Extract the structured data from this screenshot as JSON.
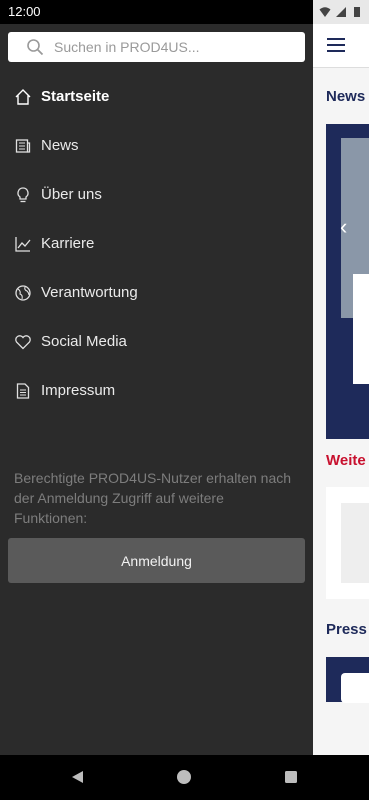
{
  "status": {
    "time": "12:00"
  },
  "drawer": {
    "search_placeholder": "Suchen in PROD4US...",
    "items": [
      {
        "label": "Startseite",
        "icon": "home-icon",
        "active": true
      },
      {
        "label": "News",
        "icon": "newspaper-icon"
      },
      {
        "label": "Über uns",
        "icon": "lightbulb-icon"
      },
      {
        "label": "Karriere",
        "icon": "chart-line-icon"
      },
      {
        "label": "Verantwortung",
        "icon": "globe-icon"
      },
      {
        "label": "Social Media",
        "icon": "heart-icon"
      },
      {
        "label": "Impressum",
        "icon": "document-icon"
      }
    ],
    "info_text": "Berechtigte PROD4US-Nutzer erhalten nach der Anmeldung Zugriff auf weitere Funktionen:",
    "login_label": "Anmeldung"
  },
  "background": {
    "section_news": "News",
    "section_more": "Weite",
    "section_press": "Press"
  },
  "colors": {
    "drawer_bg": "#2b2b2b",
    "accent_navy": "#1e2a5a",
    "accent_red": "#c8102e"
  }
}
